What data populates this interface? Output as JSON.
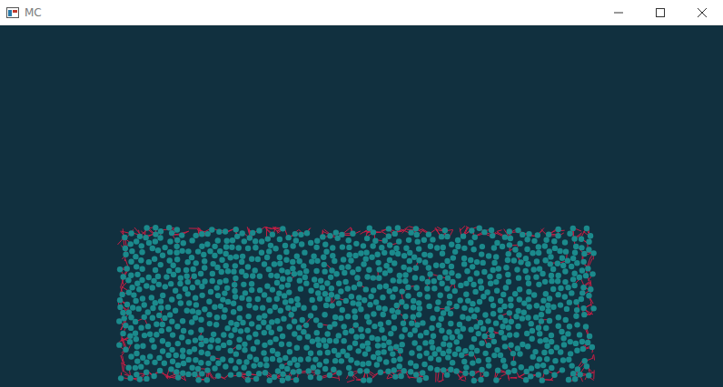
{
  "window": {
    "title": "MC"
  },
  "simulation": {
    "layers": [
      {
        "kind": "particles",
        "color": "#1b8a8c"
      },
      {
        "kind": "boundary",
        "color": "#c81e45"
      }
    ]
  }
}
